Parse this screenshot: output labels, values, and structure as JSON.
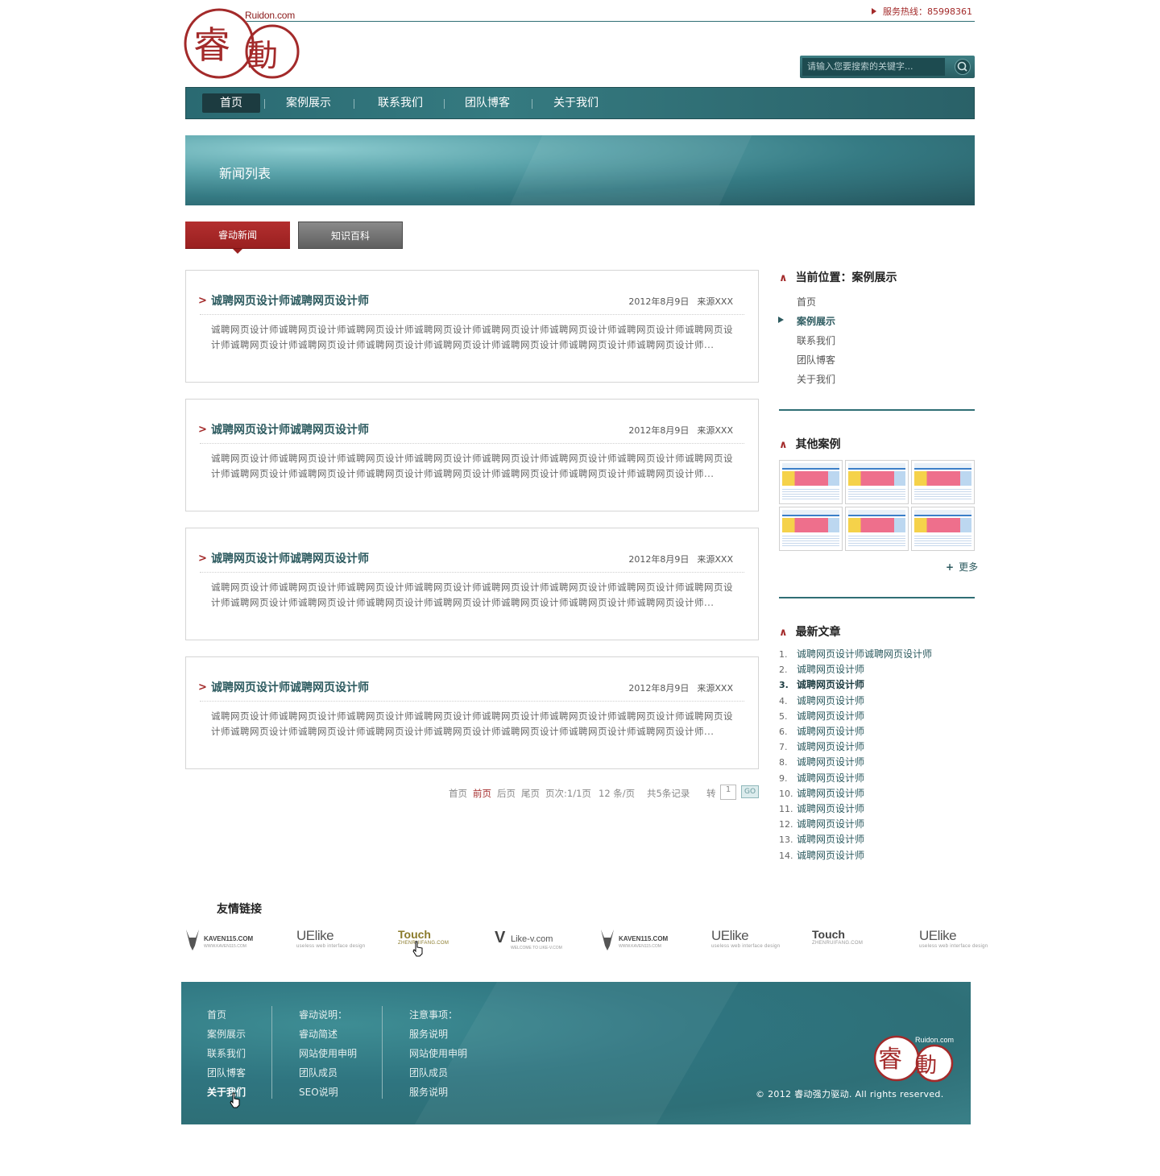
{
  "header": {
    "logo_site": "Ruidon.com",
    "logo_char1": "睿",
    "logo_char2": "動",
    "hotline_label": "服务热线：",
    "hotline_number": "85998361",
    "search_placeholder": "请输入您要搜索的关键字..."
  },
  "nav": {
    "items": [
      {
        "label": "首页",
        "active": true
      },
      {
        "label": "案例展示"
      },
      {
        "label": "联系我们"
      },
      {
        "label": "团队博客"
      },
      {
        "label": "关于我们"
      }
    ]
  },
  "banner": {
    "title": "新闻列表"
  },
  "tabs": [
    {
      "label": "睿动新闻",
      "active": true
    },
    {
      "label": "知识百科"
    }
  ],
  "articles": [
    {
      "title": "诚聘网页设计师诚聘网页设计师",
      "date": "2012年8月9日",
      "source": "来源XXX",
      "body": "诚聘网页设计师诚聘网页设计师诚聘网页设计师诚聘网页设计师诚聘网页设计师诚聘网页设计师诚聘网页设计师诚聘网页设计师诚聘网页设计师诚聘网页设计师诚聘网页设计师诚聘网页设计师诚聘网页设计师诚聘网页设计师诚聘网页设计师..."
    },
    {
      "title": "诚聘网页设计师诚聘网页设计师",
      "date": "2012年8月9日",
      "source": "来源XXX",
      "body": "诚聘网页设计师诚聘网页设计师诚聘网页设计师诚聘网页设计师诚聘网页设计师诚聘网页设计师诚聘网页设计师诚聘网页设计师诚聘网页设计师诚聘网页设计师诚聘网页设计师诚聘网页设计师诚聘网页设计师诚聘网页设计师诚聘网页设计师..."
    },
    {
      "title": "诚聘网页设计师诚聘网页设计师",
      "date": "2012年8月9日",
      "source": "来源XXX",
      "body": "诚聘网页设计师诚聘网页设计师诚聘网页设计师诚聘网页设计师诚聘网页设计师诚聘网页设计师诚聘网页设计师诚聘网页设计师诚聘网页设计师诚聘网页设计师诚聘网页设计师诚聘网页设计师诚聘网页设计师诚聘网页设计师诚聘网页设计师..."
    },
    {
      "title": "诚聘网页设计师诚聘网页设计师",
      "date": "2012年8月9日",
      "source": "来源XXX",
      "body": "诚聘网页设计师诚聘网页设计师诚聘网页设计师诚聘网页设计师诚聘网页设计师诚聘网页设计师诚聘网页设计师诚聘网页设计师诚聘网页设计师诚聘网页设计师诚聘网页设计师诚聘网页设计师诚聘网页设计师诚聘网页设计师诚聘网页设计师..."
    }
  ],
  "pager": {
    "first": "首页",
    "prev": "前页",
    "next": "后页",
    "last": "尾页",
    "page_info": "页次:1/1页",
    "per_page": "12 条/页",
    "total": "共5条记录",
    "goto_label": "转",
    "page_value": "1",
    "go": "GO"
  },
  "sidebar": {
    "location_title": "当前位置：案例展示",
    "location_links": [
      "首页",
      "案例展示",
      "联系我们",
      "团队博客",
      "关于我们"
    ],
    "other_cases_title": "其他案例",
    "more": "更多",
    "latest_title": "最新文章",
    "latest": [
      {
        "num": "1.",
        "title": "诚聘网页设计师诚聘网页设计师"
      },
      {
        "num": "2.",
        "title": "诚聘网页设计师"
      },
      {
        "num": "3.",
        "title": "诚聘网页设计师"
      },
      {
        "num": "4.",
        "title": "诚聘网页设计师"
      },
      {
        "num": "5.",
        "title": "诚聘网页设计师"
      },
      {
        "num": "6.",
        "title": "诚聘网页设计师"
      },
      {
        "num": "7.",
        "title": "诚聘网页设计师"
      },
      {
        "num": "8.",
        "title": "诚聘网页设计师"
      },
      {
        "num": "9.",
        "title": "诚聘网页设计师"
      },
      {
        "num": "10.",
        "title": "诚聘网页设计师"
      },
      {
        "num": "11.",
        "title": "诚聘网页设计师"
      },
      {
        "num": "12.",
        "title": "诚聘网页设计师"
      },
      {
        "num": "13.",
        "title": "诚聘网页设计师"
      },
      {
        "num": "14.",
        "title": "诚聘网页设计师"
      }
    ]
  },
  "friends": {
    "title": "友情链接",
    "partners": [
      {
        "name": "KAVEN115.COM",
        "sub": "WWW.KAVEN115.COM"
      },
      {
        "name": "UElike",
        "sub": "useless web interface design"
      },
      {
        "name": "Touch",
        "sub": "ZHENRUIFANG.COM"
      },
      {
        "name": "Like-v.com",
        "sub": "WELCOME TO LIKE-V.COM"
      },
      {
        "name": "KAVEN115.COM",
        "sub": "WWW.KAVEN115.COM"
      },
      {
        "name": "UElike",
        "sub": "useless web interface design"
      },
      {
        "name": "Touch",
        "sub": "ZHENRUIFANG.COM"
      },
      {
        "name": "UElike",
        "sub": "useless web interface design"
      }
    ]
  },
  "footer": {
    "col1": [
      "首页",
      "案例展示",
      "联系我们",
      "团队博客",
      "关于我们"
    ],
    "col2": [
      "睿动说明：",
      "睿动简述",
      "网站使用申明",
      "团队成员",
      "SEO说明"
    ],
    "col3": [
      "注意事项：",
      "服务说明",
      "网站使用申明",
      "团队成员",
      "服务说明"
    ],
    "copyright": "© 2012 睿动强力驱动. All rights reserved.",
    "logo_site": "Ruidon.com"
  },
  "colors": {
    "brand_red": "#a32a2a",
    "brand_teal": "#2f6e74",
    "dark_teal": "#1c3b40"
  }
}
